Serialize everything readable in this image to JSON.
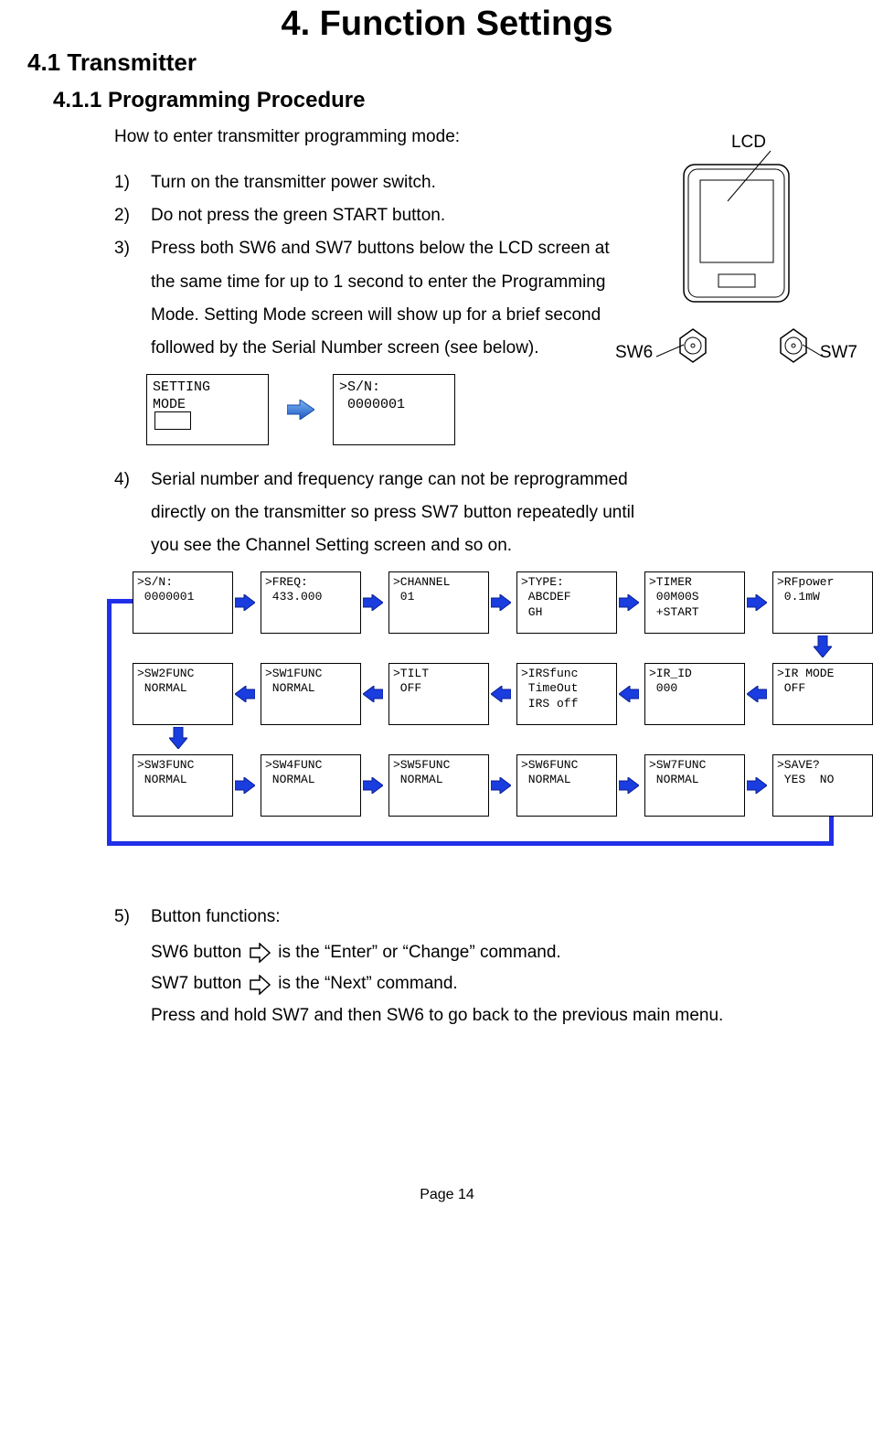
{
  "chapter_title": "4. Function Settings",
  "section_4_1": "4.1   Transmitter",
  "section_4_1_1": "4.1.1    Programming Procedure",
  "intro": "How to enter transmitter programming mode:",
  "steps": {
    "s1_num": "1)",
    "s1_txt": "Turn on the transmitter power switch.",
    "s2_num": "2)",
    "s2_txt": "Do not press the green START button.",
    "s3_num": "3)",
    "s3_txt": "Press both SW6 and SW7 buttons below the LCD screen at the same time for up to 1 second to enter the Programming Mode. Setting Mode screen will show up for a brief second followed by the Serial Number screen (see below).",
    "s4_num": "4)",
    "s4_txt": "Serial number and frequency range can not be reprogrammed directly on the transmitter so press SW7 button repeatedly until you see the Channel Setting screen and so on.",
    "s5_num": "5)",
    "s5_txt": "Button functions:"
  },
  "device_labels": {
    "lcd": "LCD",
    "sw6": "SW6",
    "sw7": "SW7"
  },
  "seq_screens": {
    "setting_mode": "SETTING\nMODE",
    "sn": ">S/N:\n 0000001"
  },
  "flow": {
    "sn": ">S/N:\n 0000001",
    "freq": ">FREQ:\n 433.000",
    "channel": ">CHANNEL\n 01",
    "type": ">TYPE:\n ABCDEF\n GH",
    "timer": ">TIMER\n 00M00S\n +START",
    "rfpower": ">RFpower\n 0.1mW",
    "sw2func": ">SW2FUNC\n NORMAL",
    "sw1func": ">SW1FUNC\n NORMAL",
    "tilt": ">TILT\n OFF",
    "irsfunc": ">IRSfunc\n TimeOut\n IRS off",
    "ir_id": ">IR_ID\n 000",
    "ir_mode": ">IR MODE\n OFF",
    "sw3func": ">SW3FUNC\n NORMAL",
    "sw4func": ">SW4FUNC\n NORMAL",
    "sw5func": ">SW5FUNC\n NORMAL",
    "sw6func": ">SW6FUNC\n NORMAL",
    "sw7func": ">SW7FUNC\n NORMAL",
    "save": ">SAVE?\n YES  NO"
  },
  "button_functions": {
    "sw6_pre": "SW6 button",
    "sw6_post": " is the “Enter” or “Change” command.",
    "sw7_pre": "SW7 button",
    "sw7_post": " is the “Next” command.",
    "back_line": "Press and hold SW7 and then SW6 to go back to the previous main menu."
  },
  "page_num": "Page 14"
}
